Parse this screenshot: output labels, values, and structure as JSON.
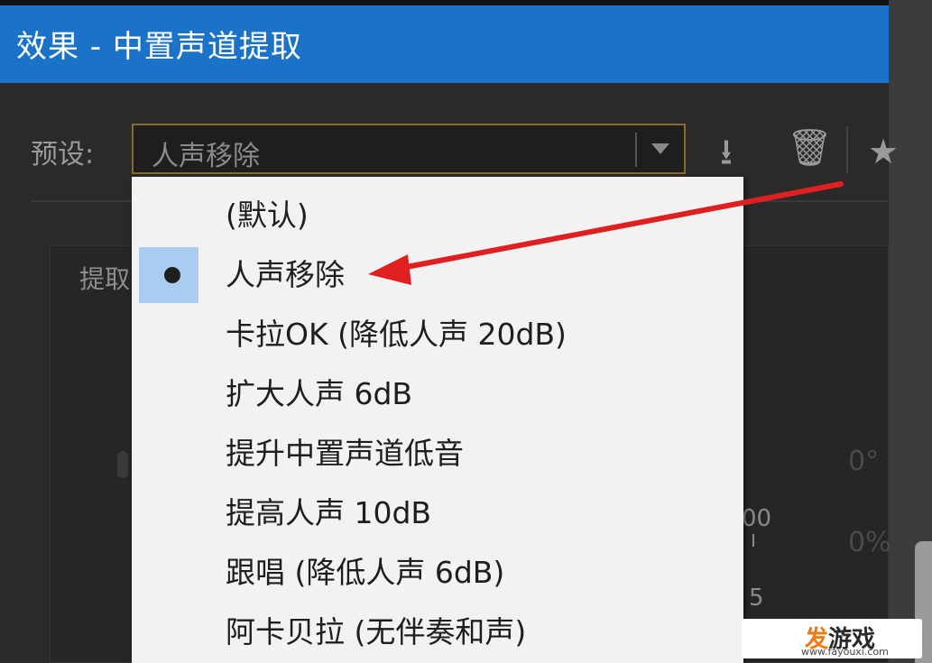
{
  "window": {
    "title": "效果 - 中置声道提取"
  },
  "preset": {
    "label": "预设:",
    "selected_value": "人声移除",
    "save_icon": "save-preset-icon",
    "delete_icon": "trash-icon",
    "favorite_icon": "star-icon"
  },
  "tabs": [
    {
      "label": "提取"
    }
  ],
  "background_values": {
    "v100": "00",
    "v5": "5",
    "deg": "0°",
    "pct": "0%"
  },
  "dropdown": {
    "items": [
      {
        "label": "(默认)",
        "selected": false
      },
      {
        "label": "人声移除",
        "selected": true
      },
      {
        "label": "卡拉OK (降低人声 20dB)",
        "selected": false
      },
      {
        "label": "扩大人声 6dB",
        "selected": false
      },
      {
        "label": "提升中置声道低音",
        "selected": false
      },
      {
        "label": "提高人声 10dB",
        "selected": false
      },
      {
        "label": "跟唱 (降低人声 6dB)",
        "selected": false
      },
      {
        "label": "阿卡贝拉 (无伴奏和声)",
        "selected": false
      }
    ]
  },
  "annotation": {
    "arrow_color": "#e02020"
  },
  "watermark": {
    "logo_accent": "发",
    "logo_rest": "游戏",
    "url": "www.fayouxi.com"
  },
  "colors": {
    "title_bar": "#1a73c8",
    "selection": "#a8cdf0"
  }
}
